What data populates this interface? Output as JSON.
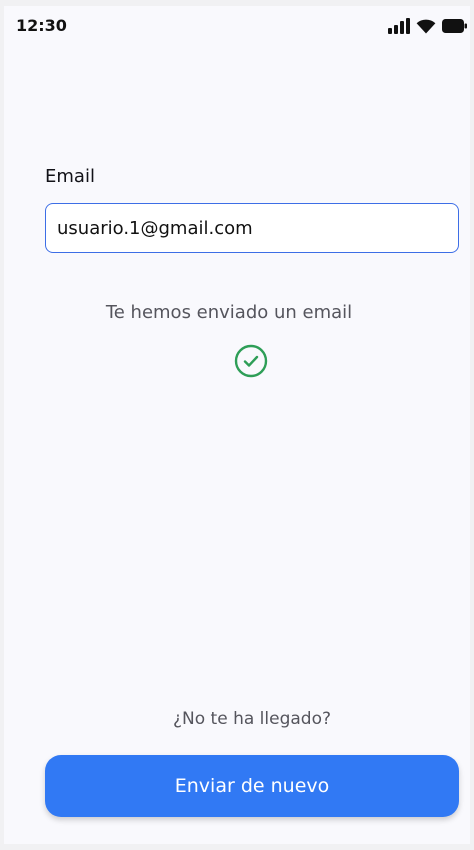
{
  "status_bar": {
    "time": "12:30",
    "icons": [
      "signal-icon",
      "wifi-icon",
      "battery-icon"
    ]
  },
  "form": {
    "email_label": "Email",
    "email_value": "usuario.1@gmail.com"
  },
  "confirmation": {
    "message": "Te hemos enviado un email",
    "icon": "check-circle-icon",
    "icon_color": "#2e9e57"
  },
  "footer": {
    "not_arrived_text": "¿No te ha llegado?",
    "resend_label": "Enviar de nuevo",
    "button_color": "#3179f4"
  }
}
